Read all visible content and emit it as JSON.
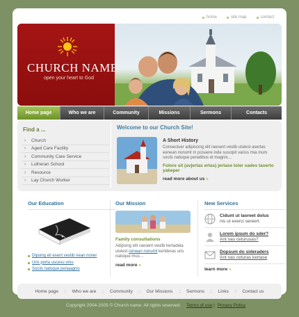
{
  "top_links": [
    "home",
    "site map",
    "contact"
  ],
  "brand": {
    "title": "CHURCH NAME",
    "tagline": "open your heart to God"
  },
  "nav": [
    "Home page",
    "Who we are",
    "Community",
    "Missions",
    "Sermons",
    "Contacts"
  ],
  "nav_active": 0,
  "find": {
    "title": "Find a ...",
    "items": [
      "Church",
      "Aged Care Facility",
      "Community Care Service",
      "Lutheran School",
      "Resource",
      "Lay Church Worker"
    ]
  },
  "welcome": {
    "title": "Welcome to our Church Site!",
    "history_title": "A Short History",
    "history_text": "Consectuer adipiscing elit raesent vestib ululest asertas eenean nonumt m posuere inde suscipit varius mia mum sociis natoque penatibus et magnis…",
    "highlight": "Folore sit (avjertas ertas) jertase toler sades taserto yakeper",
    "read_more": "read more about us"
  },
  "education": {
    "title": "Our Education",
    "links": [
      "Dipsing eli esent vestib nean noner",
      "Uris porta uscevu vmu",
      "Sociis natoque penaagnis"
    ]
  },
  "mission": {
    "title": "Our Mission",
    "subtitle": "Family consultations",
    "text_before": "Adipsing elit raesent vestib kertadela ululest ",
    "text_link": "cenean nonumt",
    "text_after": " kertderas uris natoque mus…",
    "read_more": "read more"
  },
  "services": {
    "title": "New Services",
    "items": [
      {
        "icon": "globe-icon",
        "title": "Cidunt ut laoreet dolus",
        "sub": "nis ut exerci sereert.",
        "underlined": false
      },
      {
        "icon": "user-icon",
        "title": "Lorem ipsum do sder?",
        "sub": "Ant nas ceturusas?",
        "underlined": true
      },
      {
        "icon": "mail-icon",
        "title": "Dopsum do sideraders",
        "sub": "Ant nas ceturas kertase",
        "underlined": true
      }
    ],
    "read_more": "learn more"
  },
  "footer_nav": [
    "Home page",
    "Who we are",
    "Community",
    "Our Missions",
    "Sermons",
    "Links",
    "Contact us"
  ],
  "copyright": {
    "text": "Copyright 2004-2005 © Church name.  All rights reserved.",
    "terms": "Terms of use",
    "privacy": "Privacy Policy"
  },
  "colors": {
    "background": "#7d9164",
    "brand_red": "#9b1010",
    "accent_green": "#7aa334",
    "heading_blue": "#2f6f9c"
  }
}
